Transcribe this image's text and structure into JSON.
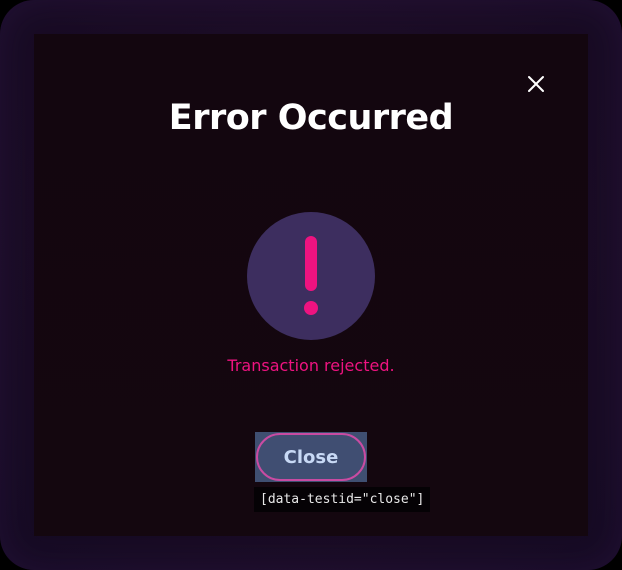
{
  "dialog": {
    "title": "Error Occurred",
    "message": "Transaction rejected.",
    "close_icon": "close-icon",
    "alert_icon": "exclamation-icon",
    "close_button_label": "Close",
    "selector_tooltip": "[data-testid=\"close\"]"
  },
  "colors": {
    "accent_pink": "#ee1380",
    "icon_circle": "#3d2e5f",
    "button_bg": "#404e72",
    "button_border": "#c94ba2",
    "button_text": "#c8d9f5"
  }
}
